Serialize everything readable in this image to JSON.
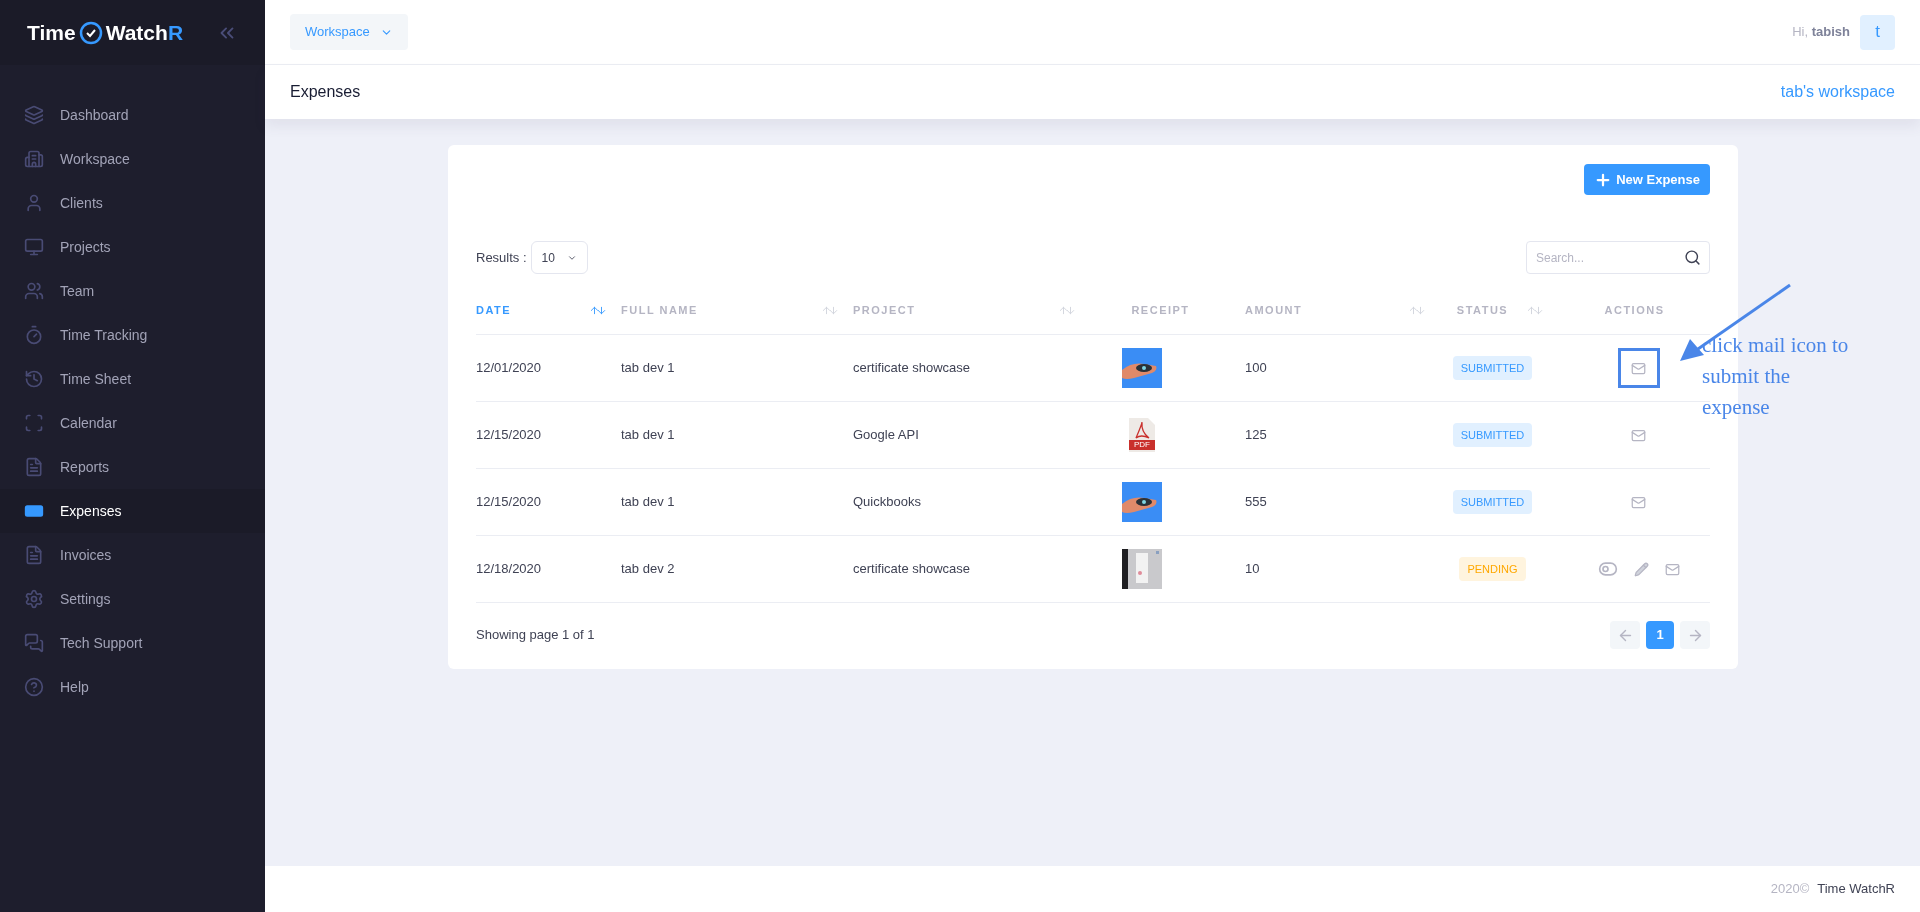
{
  "logo": {
    "before": "Time",
    "name": "Watch",
    "accent": "R"
  },
  "sidebar": {
    "items": [
      {
        "label": "Dashboard",
        "selected": false
      },
      {
        "label": "Workspace",
        "selected": false
      },
      {
        "label": "Clients",
        "selected": false
      },
      {
        "label": "Projects",
        "selected": false
      },
      {
        "label": "Team",
        "selected": false
      },
      {
        "label": "Time Tracking",
        "selected": false
      },
      {
        "label": "Time Sheet",
        "selected": false
      },
      {
        "label": "Calendar",
        "selected": false
      },
      {
        "label": "Reports",
        "selected": false
      },
      {
        "label": "Expenses",
        "selected": true
      },
      {
        "label": "Invoices",
        "selected": false
      },
      {
        "label": "Settings",
        "selected": false
      },
      {
        "label": "Tech Support",
        "selected": false
      },
      {
        "label": "Help",
        "selected": false
      }
    ]
  },
  "topbar": {
    "workspace_menu": "Workspace",
    "greeting": "Hi,",
    "user": "tabish",
    "avatar": "t"
  },
  "subheader": {
    "title": "Expenses",
    "workspace": "tab's workspace"
  },
  "card": {
    "new_button": "New Expense",
    "results_label": "Results :",
    "results_value": "10",
    "search": {
      "placeholder": "Search..."
    },
    "columns": [
      {
        "label": "DATE",
        "sortable": true,
        "active": true
      },
      {
        "label": "FULL NAME",
        "sortable": true,
        "active": false
      },
      {
        "label": "PROJECT",
        "sortable": true,
        "active": false
      },
      {
        "label": "RECEIPT",
        "sortable": false,
        "active": false
      },
      {
        "label": "AMOUNT",
        "sortable": true,
        "active": false
      },
      {
        "label": "STATUS",
        "sortable": true,
        "active": false
      },
      {
        "label": "ACTIONS",
        "sortable": false,
        "active": false
      }
    ],
    "rows": [
      {
        "date": "12/01/2020",
        "name": "tab dev 1",
        "project": "certificate showcase",
        "amount": "100",
        "status": {
          "kind": "submitted",
          "text": "SUBMITTED"
        },
        "actions": [
          {
            "kind": "mail"
          }
        ],
        "highlighted": true
      },
      {
        "date": "12/15/2020",
        "name": "tab dev 1",
        "project": "Google API",
        "receipt": {
          "kind": "pdf",
          "label": "PDF"
        },
        "amount": "125",
        "status": {
          "kind": "submitted",
          "text": "SUBMITTED"
        },
        "actions": [
          {
            "kind": "mail"
          }
        ],
        "highlighted": false
      },
      {
        "date": "12/15/2020",
        "name": "tab dev 1",
        "project": "Quickbooks",
        "amount": "555",
        "status": {
          "kind": "submitted",
          "text": "SUBMITTED"
        },
        "actions": [
          {
            "kind": "mail"
          }
        ],
        "highlighted": false
      },
      {
        "date": "12/18/2020",
        "name": "tab dev 2",
        "project": "certificate showcase",
        "receipt": {
          "kind": "scan"
        },
        "amount": "10",
        "status": {
          "kind": "pending",
          "text": "PENDING"
        },
        "actions": [
          {
            "kind": "toggle"
          },
          {
            "kind": "edit"
          },
          {
            "kind": "mail"
          }
        ],
        "highlighted": false
      }
    ],
    "page_info": "Showing page 1 of 1",
    "pages": [
      {
        "label": "1",
        "selected": true
      }
    ]
  },
  "annotation": {
    "text": "click mail icon to submit the expense"
  },
  "footer": {
    "year": "2020©",
    "brand": "Time WatchR"
  }
}
